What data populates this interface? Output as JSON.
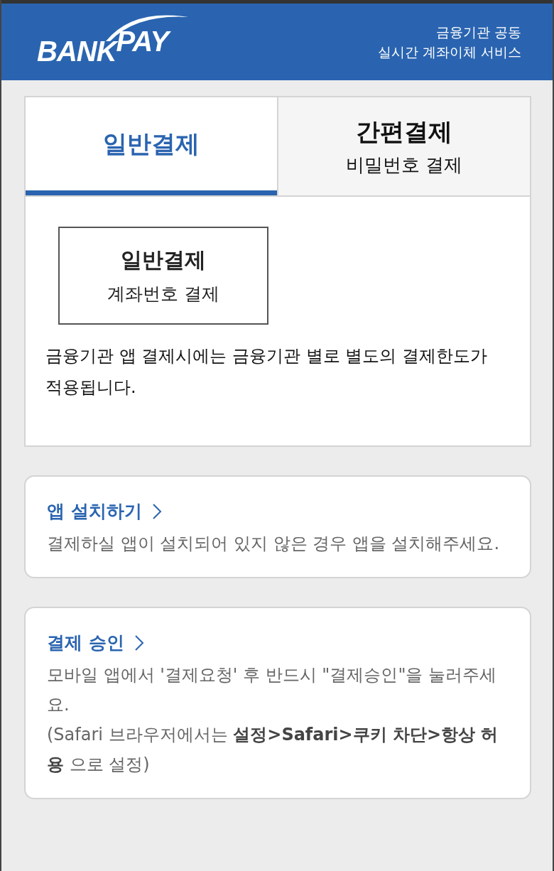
{
  "header": {
    "logo": "BANK$^{PAY}$",
    "tagline": [
      "금융기관 공동",
      "실시간 계좌이체 서비스"
    ]
  },
  "tabs": [
    {
      "title": "일반결제",
      "selected": true
    },
    {
      "title": "간편결제",
      "subtitle": "비밀번호 결제",
      "selected": false
    }
  ],
  "payment_option": {
    "title": "일반결제",
    "subtitle": "계좌번호 결제"
  },
  "notice": "금융기관 앱 결제시에는 금융기관 별로 별도의 결제한도가 적용됩니다.",
  "cards": [
    {
      "title": "앱 설치하기",
      "lines": [
        "결제하실 앱이 설치되어 있지 않은 경우 앱을 설치해주세요."
      ]
    },
    {
      "title": "결제 승인",
      "lines": [
        "모바일 앱에서 '결제요청' 후 반드시 \"결제승인\"을 눌러주세요.",
        "(Safari 브라우저에서는 **설정>Safari>쿠키 차단>항상 허용** 으로 설정)"
      ]
    }
  ]
}
